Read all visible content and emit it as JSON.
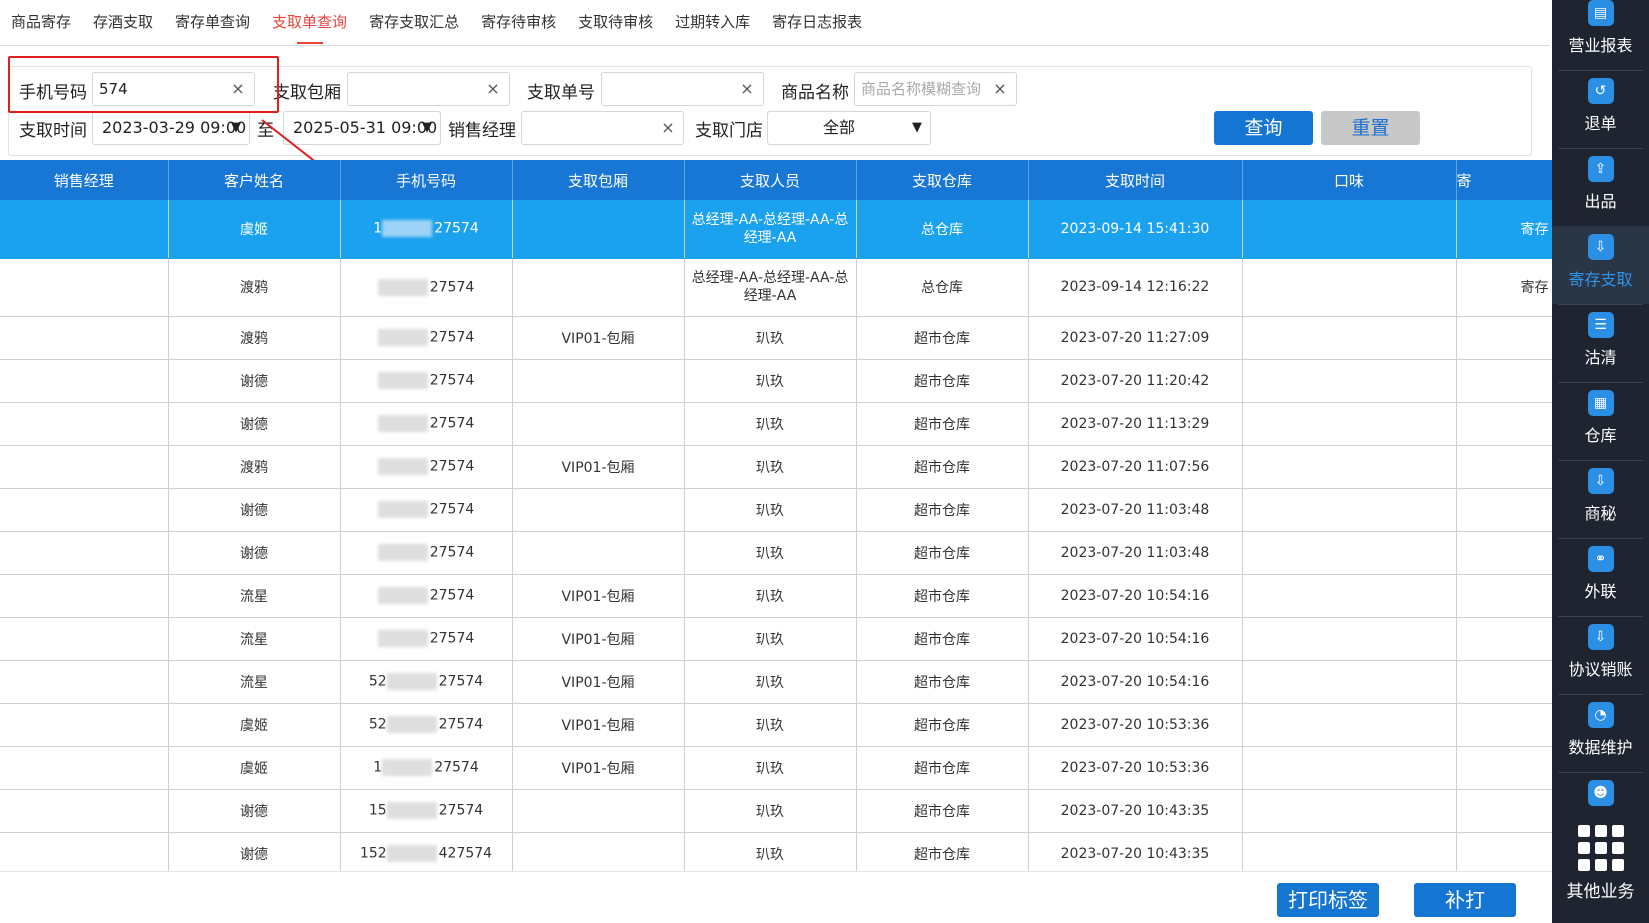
{
  "tabs": [
    "商品寄存",
    "存酒支取",
    "寄存单查询",
    "支取单查询",
    "寄存支取汇总",
    "寄存待审核",
    "支取待审核",
    "过期转入库",
    "寄存日志报表"
  ],
  "active_tab": "支取单查询",
  "filters": {
    "phone_label": "手机号码",
    "phone_value": "574",
    "room_label": "支取包厢",
    "room_value": "",
    "order_label": "支取单号",
    "order_value": "",
    "product_label": "商品名称",
    "product_placeholder": "商品名称模糊查询",
    "time_label": "支取时间",
    "time_start": "2023-03-29 09:00",
    "time_to": "至",
    "time_end": "2025-05-31 09:00",
    "manager_label": "销售经理",
    "manager_value": "",
    "store_label": "支取门店",
    "store_value": "全部",
    "clear_glyph": "×",
    "caret_glyph": "▼",
    "query_label": "查询",
    "reset_label": "重置"
  },
  "table": {
    "headers": [
      "销售经理",
      "客户姓名",
      "手机号码",
      "支取包厢",
      "支取人员",
      "支取仓库",
      "支取时间",
      "口味",
      "寄"
    ],
    "rows": [
      {
        "manager": "",
        "customer": "虞姬",
        "phone_prefix": "1",
        "phone_suffix": "27574",
        "room": "",
        "staff": "总经理-AA-总经理-AA-总经理-AA",
        "warehouse": "总仓库",
        "time": "2023-09-14 15:41:30",
        "flavor": "",
        "extra": "寄存"
      },
      {
        "manager": "",
        "customer": "渡鸦",
        "phone_prefix": "",
        "phone_suffix": "27574",
        "room": "",
        "staff": "总经理-AA-总经理-AA-总经理-AA",
        "warehouse": "总仓库",
        "time": "2023-09-14 12:16:22",
        "flavor": "",
        "extra": "寄存"
      },
      {
        "manager": "",
        "customer": "渡鸦",
        "phone_prefix": "",
        "phone_suffix": "27574",
        "room": "VIP01-包厢",
        "staff": "玐玖",
        "warehouse": "超市仓库",
        "time": "2023-07-20 11:27:09",
        "flavor": "",
        "extra": ""
      },
      {
        "manager": "",
        "customer": "谢德",
        "phone_prefix": "",
        "phone_suffix": "27574",
        "room": "",
        "staff": "玐玖",
        "warehouse": "超市仓库",
        "time": "2023-07-20 11:20:42",
        "flavor": "",
        "extra": ""
      },
      {
        "manager": "",
        "customer": "谢德",
        "phone_prefix": "",
        "phone_suffix": "27574",
        "room": "",
        "staff": "玐玖",
        "warehouse": "超市仓库",
        "time": "2023-07-20 11:13:29",
        "flavor": "",
        "extra": ""
      },
      {
        "manager": "",
        "customer": "渡鸦",
        "phone_prefix": "",
        "phone_suffix": "27574",
        "room": "VIP01-包厢",
        "staff": "玐玖",
        "warehouse": "超市仓库",
        "time": "2023-07-20 11:07:56",
        "flavor": "",
        "extra": ""
      },
      {
        "manager": "",
        "customer": "谢德",
        "phone_prefix": "",
        "phone_suffix": "27574",
        "room": "",
        "staff": "玐玖",
        "warehouse": "超市仓库",
        "time": "2023-07-20 11:03:48",
        "flavor": "",
        "extra": ""
      },
      {
        "manager": "",
        "customer": "谢德",
        "phone_prefix": "",
        "phone_suffix": "27574",
        "room": "",
        "staff": "玐玖",
        "warehouse": "超市仓库",
        "time": "2023-07-20 11:03:48",
        "flavor": "",
        "extra": ""
      },
      {
        "manager": "",
        "customer": "流星",
        "phone_prefix": "",
        "phone_suffix": "27574",
        "room": "VIP01-包厢",
        "staff": "玐玖",
        "warehouse": "超市仓库",
        "time": "2023-07-20 10:54:16",
        "flavor": "",
        "extra": ""
      },
      {
        "manager": "",
        "customer": "流星",
        "phone_prefix": "",
        "phone_suffix": "27574",
        "room": "VIP01-包厢",
        "staff": "玐玖",
        "warehouse": "超市仓库",
        "time": "2023-07-20 10:54:16",
        "flavor": "",
        "extra": ""
      },
      {
        "manager": "",
        "customer": "流星",
        "phone_prefix": "52",
        "phone_suffix": "27574",
        "room": "VIP01-包厢",
        "staff": "玐玖",
        "warehouse": "超市仓库",
        "time": "2023-07-20 10:54:16",
        "flavor": "",
        "extra": ""
      },
      {
        "manager": "",
        "customer": "虞姬",
        "phone_prefix": "52",
        "phone_suffix": "27574",
        "room": "VIP01-包厢",
        "staff": "玐玖",
        "warehouse": "超市仓库",
        "time": "2023-07-20 10:53:36",
        "flavor": "",
        "extra": ""
      },
      {
        "manager": "",
        "customer": "虞姬",
        "phone_prefix": "1",
        "phone_suffix": "27574",
        "room": "VIP01-包厢",
        "staff": "玐玖",
        "warehouse": "超市仓库",
        "time": "2023-07-20 10:53:36",
        "flavor": "",
        "extra": ""
      },
      {
        "manager": "",
        "customer": "谢德",
        "phone_prefix": "15",
        "phone_suffix": "27574",
        "room": "",
        "staff": "玐玖",
        "warehouse": "超市仓库",
        "time": "2023-07-20 10:43:35",
        "flavor": "",
        "extra": ""
      },
      {
        "manager": "",
        "customer": "谢德",
        "phone_prefix": "152",
        "phone_suffix": "427574",
        "room": "",
        "staff": "玐玖",
        "warehouse": "超市仓库",
        "time": "2023-07-20 10:43:35",
        "flavor": "",
        "extra": ""
      }
    ]
  },
  "bottom": {
    "print_label": "打印标签",
    "reprint_label": "补打"
  },
  "sidebar": {
    "items": [
      {
        "label": "营业报表",
        "icon": "chart-icon",
        "glyph": "▤"
      },
      {
        "label": "退单",
        "icon": "return-icon",
        "glyph": "↺"
      },
      {
        "label": "出品",
        "icon": "export-icon",
        "glyph": "⇪"
      },
      {
        "label": "寄存支取",
        "icon": "download-icon",
        "glyph": "⇩"
      },
      {
        "label": "沽清",
        "icon": "list-icon",
        "glyph": "☰"
      },
      {
        "label": "仓库",
        "icon": "grid-icon",
        "glyph": "▦"
      },
      {
        "label": "商秘",
        "icon": "download-icon",
        "glyph": "⇩"
      },
      {
        "label": "外联",
        "icon": "link-icon",
        "glyph": "⚭"
      },
      {
        "label": "协议销账",
        "icon": "download-icon",
        "glyph": "⇩"
      },
      {
        "label": "数据维护",
        "icon": "pie-icon",
        "glyph": "◔"
      },
      {
        "label": "",
        "icon": "person-icon",
        "glyph": "☻"
      }
    ],
    "active": "寄存支取",
    "other_label": "其他业务"
  },
  "colors": {
    "accent": "#1877d4",
    "selected_row": "#1aa2ef",
    "active_tab": "#e8453c",
    "highlight": "#e02020",
    "sidebar_bg": "#1e2430"
  }
}
